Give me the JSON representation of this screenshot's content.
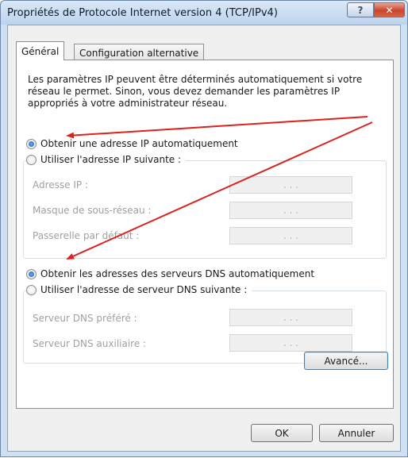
{
  "window": {
    "title": "Propriétés de Protocole Internet version 4 (TCP/IPv4)",
    "help_icon": "question-mark-icon",
    "close_icon": "close-x-icon"
  },
  "tabs": [
    {
      "label": "Général"
    },
    {
      "label": "Configuration alternative"
    }
  ],
  "description": "Les paramètres IP peuvent être déterminés automatiquement si votre réseau le permet. Sinon, vous devez demander les paramètres IP appropriés à votre administrateur réseau.",
  "ip": {
    "auto_label": "Obtenir une adresse IP automatiquement",
    "manual_label": "Utiliser l'adresse IP suivante :",
    "selected": "auto",
    "fields": [
      {
        "label": "Adresse IP :",
        "value": ". . ."
      },
      {
        "label": "Masque de sous-réseau :",
        "value": ". . ."
      },
      {
        "label": "Passerelle par défaut :",
        "value": ". . ."
      }
    ]
  },
  "dns": {
    "auto_label": "Obtenir les adresses des serveurs DNS automatiquement",
    "manual_label": "Utiliser l'adresse de serveur DNS suivante :",
    "selected": "auto",
    "fields": [
      {
        "label": "Serveur DNS préféré :",
        "value": ". . ."
      },
      {
        "label": "Serveur DNS auxiliaire :",
        "value": ". . ."
      }
    ]
  },
  "buttons": {
    "advanced": "Avancé...",
    "ok": "OK",
    "cancel": "Annuler"
  },
  "colors": {
    "annotation_arrow": "#d9231f",
    "close_button": "#c8442a",
    "radio_selected": "#1e5fb5"
  }
}
